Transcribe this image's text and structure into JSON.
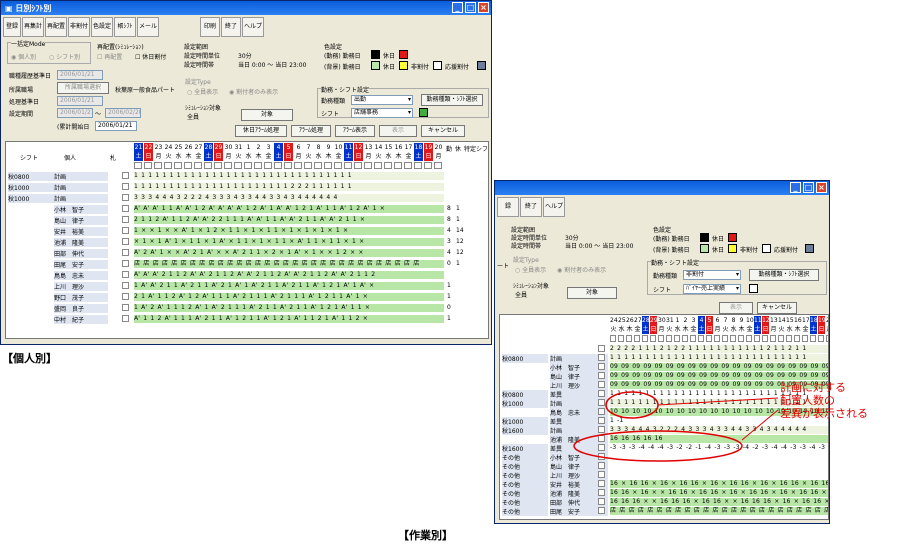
{
  "win1": {
    "title": "日別ｼﾌﾄ別",
    "toolbar": [
      "登録",
      "再集計",
      "再配置",
      "非割付",
      "色設定",
      "帳ｼﾌﾄ",
      "メール",
      "印刷",
      "終了",
      "ヘルプ"
    ],
    "mode_group": "一括定Mode",
    "mode_opt1": "個人別",
    "mode_opt2": "シフト別",
    "realloc_label": "再配置(ｼﾐｭﾚｰｼｮﾝ)",
    "realloc_opt1": "再配置",
    "realloc_opt2": "休日割付",
    "period_label": "設定範囲",
    "unit_label": "設定時間単位",
    "unit_value": "30分",
    "range_label": "設定時間帯",
    "range_value": "当日 0:00  ～  当日 23:00",
    "color_label": "色設定",
    "color_row1": "(勤務)  勤務日",
    "color_holiday": "休日",
    "color_row2": "(背景)  勤務日",
    "color_holiday2": "休日",
    "color_nonassign": "非割付",
    "color_support": "応援割付",
    "base_date_label": "職種履歴基準日",
    "base_date": "2006/01/21",
    "shop_label": "所属職場",
    "shop_btn": "所属職場選択",
    "shop_value": "秋葉原一般食品パート",
    "proc_date_label": "処理基準日",
    "proc_date": "2006/01/21",
    "period2_label": "設定期間",
    "period2_from": "2006/01/21",
    "period2_tilde": "～",
    "period2_to": "2006/02/20",
    "cum_label": "(累計開始日",
    "cum_date": "2006/01/21",
    "type_label": "設定Type",
    "type_opt1": "全員表示",
    "type_opt2": "割付者のみ表示",
    "sim_label": "ｼﾐｭﾚｰｼｮﾝ対象",
    "sim_value": "全員",
    "sim_btn": "対象",
    "work_label": "勤務・シフト設定",
    "work_kind_label": "勤務種類",
    "work_kind": "出勤",
    "work_btn": "勤務種類・ｼﾌﾄ選択",
    "shift_label": "シフト",
    "shift_value": "店舗事務",
    "buttons": [
      "休日ｱﾗｰﾑ処理",
      "ｱﾗｰﾑ処理",
      "ｱﾗｰﾑ表示",
      "表示",
      "キャンセル"
    ],
    "col_shift": "シフト",
    "col_person": "個人",
    "col_flag": "札",
    "dates": [
      "21",
      "22",
      "23",
      "24",
      "25",
      "26",
      "27",
      "28",
      "29",
      "30",
      "31",
      "1",
      "2",
      "3",
      "4",
      "5",
      "6",
      "7",
      "8",
      "9",
      "10",
      "11",
      "12",
      "13",
      "14",
      "15",
      "16",
      "17",
      "18",
      "19",
      "20"
    ],
    "days": [
      "土",
      "日",
      "月",
      "火",
      "水",
      "木",
      "金",
      "土",
      "日",
      "月",
      "火",
      "水",
      "木",
      "金",
      "土",
      "日",
      "月",
      "火",
      "水",
      "木",
      "金",
      "土",
      "日",
      "月",
      "火",
      "水",
      "木",
      "金",
      "土",
      "日",
      "月"
    ],
    "extra_cols": [
      "勤",
      "休",
      "特定シフ"
    ],
    "rows": [
      {
        "shift": "秋0800",
        "person": "計画",
        "cells": "1 1 1 1 1 1 1 1 1 1 1 1 1 1 1 1 1 1 1 1 1 1 1 1 1 1 1 1 1 1 1",
        "bg": "#eef3e0"
      },
      {
        "shift": "秋1000",
        "person": "計画",
        "cells": "1 1 1 1 1 1 1 1 1 1 1 1 1 1 1 1 1 1 1 1 1 1 2 2 2 1 1 1 1 1 1",
        "bg": "#eef3e0"
      },
      {
        "shift": "秋1000",
        "person": "計画",
        "cells": "3 3 3 4 4 4 3 2 2 2 4 3 3 3 4 3 3 4 4 3 3 4 3 4 4 4 4 4 4",
        "bg": "#eef3e0"
      },
      {
        "shift": "",
        "person": "小林　智子",
        "cells": "A' A' A' 1 1 A' A' 1 2 A' A' A' A' 1 2 A' 1 A' A' 1 2 1 A' 1 1 A' 1 2 A' 1 ×",
        "bg": "#b7e6a6",
        "c1": "8",
        "c2": "1"
      },
      {
        "shift": "",
        "person": "島山　律子",
        "cells": "2 1 1 2 A' 1 1 2 A' A' 2 2 1 1 1 A' A' 1 1 A' A' 2 1 1 A' A' 2 1 1 ×",
        "bg": "#b7e6a6",
        "c1": "8",
        "c2": "1"
      },
      {
        "shift": "",
        "person": "安井　裕美",
        "cells": "1 × × 1 × × A' 1 × 1 2 × 1 1 × 1 × 1 1 × 1 × 1 × 1 × 1 ×",
        "bg": "#b7e6a6",
        "c1": "4",
        "c2": "14"
      },
      {
        "shift": "",
        "person": "池浦　隆美",
        "cells": "× 1 × 1 A' 1 × 1 1 × 1 A' × 1 1 × 1 × 1 1 × A' 1 1 × 1 1 × 1 ×",
        "bg": "#b7e6a6",
        "c1": "3",
        "c2": "12"
      },
      {
        "shift": "",
        "person": "田部　伸代",
        "cells": "A' 2 A' 1 × × A' 2 1 A' × × A' 2 1 1 × 2 × 1 A' × 1 × × 1 2 × ×",
        "bg": "#b7e6a6",
        "c1": "4",
        "c2": "12"
      },
      {
        "shift": "",
        "person": "田尾　安子",
        "cells": "店 店 店 店 店 店 店 店 店 店 店 店 店 店 店 店 店 店 店 店 店 店 店 店 店 店 店 店 店 店 店",
        "bg": "#b7e6a6",
        "c1": "0",
        "c2": "1"
      },
      {
        "shift": "",
        "person": "鳥島　忠未",
        "cells": "A' A' A' 2 1 1 2 A' A' 2 1 1 2 A' A' 2 1 1 2 A' A' 2 1 1 2 A' A' 2 1 1 2",
        "bg": "#b7e6a6",
        "c1": "",
        "c2": ""
      },
      {
        "shift": "",
        "person": "上川　理沙",
        "cells": "1 A' A' 2 1 1 A' 2 1 1 A' 2 1 A' 1 A' 2 1 1 A' 2 1 1 A' 1 2 1 A' 1 A' ×",
        "bg": "#b7e6a6",
        "c1": "1",
        "c2": ""
      },
      {
        "shift": "",
        "person": "野口　茂子",
        "cells": "2 1 A' 1 1 2 A' 1 2 A' 1 1 1 A' 2 1 1 1 A' 2 1 1 1 A' 1 2 1 1 A' 1 ×",
        "bg": "#b7e6a6",
        "c1": "1",
        "c2": ""
      },
      {
        "shift": "",
        "person": "盛岡　良子",
        "cells": "1 A' 2 A' 1 1 1 2 A' 1 A' 2 1 1 1 A' 2 1 1 A' 2 1 1 A' 1 2 1 A' 1 1 ×",
        "bg": "#b7e6a6",
        "c1": "0",
        "c2": ""
      },
      {
        "shift": "",
        "person": "中村　紀子",
        "cells": "A' 1 1 2 A' 1 1 1 A' 2 1 1 A' 1 2 1 1 A' 1 2 1 A' 1 1 2 1 A' 1 1 2 ×",
        "bg": "#b7e6a6",
        "c1": "1",
        "c2": ""
      }
    ]
  },
  "cap1": "【個人別】",
  "win2": {
    "toolbar": [
      "録",
      "終了",
      "ヘルプ"
    ],
    "period_label": "設定範囲",
    "unit_label": "設定時間単位",
    "unit_value": "30分",
    "range_label": "設定時間帯",
    "range_value": "当日 0:00  ～  当日 23:00",
    "color_label": "色設定",
    "color_row1": "(勤務)  勤務日",
    "color_holiday": "休日",
    "color_row2": "(背景)  勤務日",
    "color_holiday2": "休日",
    "color_nonassign": "非割付",
    "color_support": "応援割付",
    "cut_label": "ート",
    "type_label": "設定Type",
    "type_opt1": "全員表示",
    "type_opt2": "割付者のみ表示",
    "sim_label": "ｼﾐｭﾚｰｼｮﾝ対象",
    "sim_value": "全員",
    "sim_btn": "対象",
    "work_label": "勤務・シフト設定",
    "work_kind_label": "勤務種類",
    "work_kind": "非割付",
    "work_btn": "勤務種類・ｼﾌﾄ選択",
    "shift_label": "シフト",
    "shift_value": "ﾊﾞｲﾔｰ売上実績",
    "buttons": [
      "表示",
      "キャンセル"
    ],
    "dates": [
      "24",
      "25",
      "26",
      "27",
      "28",
      "29",
      "30",
      "31",
      "1",
      "2",
      "3",
      "4",
      "5",
      "6",
      "7",
      "8",
      "9",
      "10",
      "11",
      "12",
      "13",
      "14",
      "15",
      "16",
      "17",
      "18",
      "19",
      "20"
    ],
    "days": [
      "火",
      "水",
      "木",
      "金",
      "土",
      "日",
      "月",
      "火",
      "水",
      "木",
      "金",
      "土",
      "日",
      "月",
      "火",
      "水",
      "木",
      "金",
      "土",
      "日",
      "月",
      "火",
      "水",
      "木",
      "金",
      "土",
      "日",
      "月"
    ],
    "rows": [
      {
        "shift": "",
        "person": "",
        "cells": "2 2 2 2 1 1 1 2 1 2 2 1 1 1 1 1 1 1 1 1 1 1 2 1 1 2 1 1",
        "bg": "#eef3e0"
      },
      {
        "shift": "秋0800",
        "person": "計画",
        "cells": "1 1 1 1 1 1 1 1 1 1 1 1 1 1 1 1 1 1 1 1 1 1 1 1 1 1 1 1",
        "bg": "#eef3e0"
      },
      {
        "shift": "",
        "person": "小林　智子",
        "cells": "09 09 09 09 09 09 09 09 09 09 09 09 09 09 09 09 09 09 09 09 09 09 09 09 09 09 09 09",
        "bg": "#b7e6a6"
      },
      {
        "shift": "",
        "person": "島山　律子",
        "cells": "09 09 09 09 09 09 09 09 09 09 09 09 09 09 09 09 09 09 09 09 09 09 09 09 09 09 09 09",
        "bg": "#b7e6a6"
      },
      {
        "shift": "",
        "person": "上川　理沙",
        "cells": "09 09 09 09 09 09 09 09 09 09 09 09 09 09 09 09 09 09 09 09 09 09 09 09 09 09 09 09",
        "bg": "#b7e6a6"
      },
      {
        "shift": "秋0800",
        "person": "差異",
        "cells": "1 1 1 1 1 1 1 1 1 1 1 1 1 1 1 1 1 1 1 1 1 1 1 1 1 1 1 1",
        "bg": "#fff"
      },
      {
        "shift": "秋1000",
        "person": "計画",
        "cells": "1 1 1 1 1 1 1 1 1 1 1 1 1 1 1 1 1 1 1 1 1 1 1 1 1 1 1 1",
        "bg": "#eef3e0"
      },
      {
        "shift": "",
        "person": "鳥島　忠未",
        "cells": "10 10 10 10 10 10 10 10 10 10 10 10 10 10 10 10 10 10 10 10 10 10 10 10 10 10 10 10",
        "bg": "#b7e6a6"
      },
      {
        "shift": "秋1000",
        "person": "差異",
        "cells": "1 -1",
        "bg": "#fff"
      },
      {
        "shift": "秋1600",
        "person": "計画",
        "cells": "3 3 3 4 4 4 3 2 2 2 4 3 3 3 4 3 3 4 4 3 3 4 3 4 4 4 4 4",
        "bg": "#eef3e0"
      },
      {
        "shift": "",
        "person": "池浦　隆美",
        "cells": "16  16  16  16  16",
        "bg": "#b7e6a6"
      },
      {
        "shift": "秋1600",
        "person": "差異",
        "cells": "-3 -3 -3 -4 -4 -4 -3 -2 -2 -1 -4 -3 -3 -3 -4 -2 -3 -4 -4 -3 -3 -4 -3 -3 -4 -4 -3 -4",
        "bg": "#fff"
      },
      {
        "shift": "その他",
        "person": "小林　智子",
        "cells": "",
        "bg": "#fff"
      },
      {
        "shift": "その他",
        "person": "島山　律子",
        "cells": "",
        "bg": "#fff"
      },
      {
        "shift": "その他",
        "person": "上川　理沙",
        "cells": "",
        "bg": "#fff"
      },
      {
        "shift": "その他",
        "person": "安井　裕美",
        "cells": "16 × 16 16 × 16 × 16 16 × 16 × 16 16 × 16 × 16 16 × 16 16 × 16 16 × 16 ×",
        "bg": "#b7e6a6"
      },
      {
        "shift": "その他",
        "person": "池浦　隆美",
        "cells": "16 16 × 16 × × 16 16 × 16 16 × 16 × 16 16 × 16 × 16 16 × 16 × 16 16 × ×",
        "bg": "#b7e6a6"
      },
      {
        "shift": "その他",
        "person": "田部　伸代",
        "cells": "16 16 16 × × 16 16 16 × 16 16 × × 16 16 16 × 16 × 16 16 × 16 16 × 16 × ×",
        "bg": "#b7e6a6"
      },
      {
        "shift": "その他",
        "person": "田尾　安子",
        "cells": "店 店 店 店 店 店 店 店 店 店 店 店 店 店 店 店 店 店 店 店 店 店 店 店 店 店 店 店",
        "bg": "#b7e6a6"
      }
    ]
  },
  "annotation": [
    "計画に対する",
    "配置人数の",
    "差異が表示される"
  ],
  "cap2": "【作業別】",
  "colors": {
    "title_blue": "#0a5ddb",
    "sat_blue": "#0033cc",
    "sun_red": "#e01818",
    "green": "#b7e6a6",
    "yellow": "#ffff33",
    "annot_red": "#e00000"
  }
}
